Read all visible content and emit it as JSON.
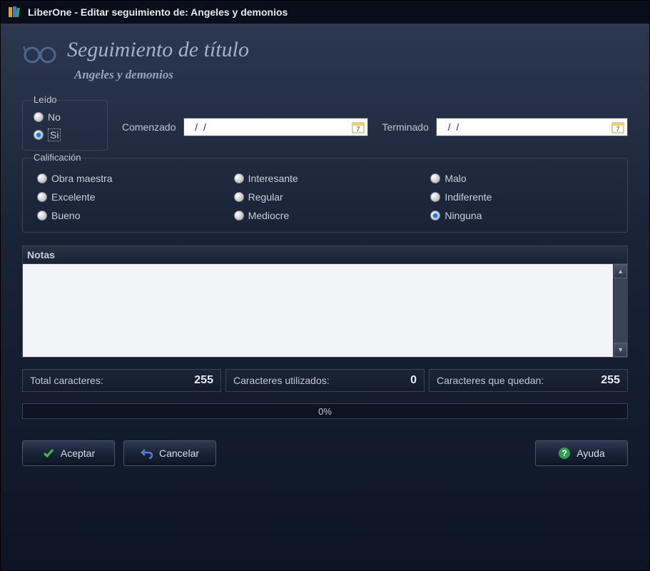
{
  "titlebar": {
    "text": "LiberOne - Editar seguimiento de: Angeles y demonios"
  },
  "header": {
    "title": "Seguimiento de título",
    "subtitle": "Angeles y demonios"
  },
  "leido": {
    "legend": "Leído",
    "options": [
      {
        "label": "No",
        "checked": false
      },
      {
        "label": "Si",
        "checked": true
      }
    ]
  },
  "dates": {
    "started": {
      "label": "Comenzado",
      "value": "  /  /"
    },
    "ended": {
      "label": "Terminado",
      "value": "  /  /"
    }
  },
  "calificacion": {
    "legend": "Calificación",
    "options": [
      {
        "label": "Obra maestra",
        "checked": false
      },
      {
        "label": "Interesante",
        "checked": false
      },
      {
        "label": "Malo",
        "checked": false
      },
      {
        "label": "Excelente",
        "checked": false
      },
      {
        "label": "Regular",
        "checked": false
      },
      {
        "label": "Indiferente",
        "checked": false
      },
      {
        "label": "Bueno",
        "checked": false
      },
      {
        "label": "Mediocre",
        "checked": false
      },
      {
        "label": "Ninguna",
        "checked": true
      }
    ]
  },
  "notas": {
    "label": "Notas",
    "value": ""
  },
  "stats": {
    "total": {
      "label": "Total caracteres:",
      "value": "255"
    },
    "used": {
      "label": "Caracteres utilizados:",
      "value": "0"
    },
    "remaining": {
      "label": "Caracteres que quedan:",
      "value": "255"
    },
    "progress": "0%"
  },
  "buttons": {
    "accept": "Aceptar",
    "cancel": "Cancelar",
    "help": "Ayuda"
  }
}
